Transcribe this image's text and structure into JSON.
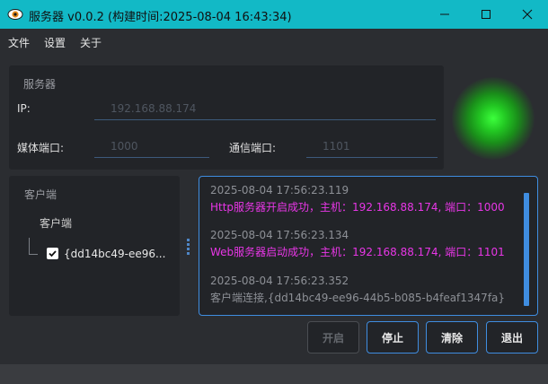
{
  "window": {
    "title": "服务器 v0.0.2 (构建时间:2025-08-04 16:43:34)",
    "accent_color": "#12b9c6"
  },
  "menu": {
    "items": [
      {
        "label": "文件"
      },
      {
        "label": "设置"
      },
      {
        "label": "关于"
      }
    ]
  },
  "server": {
    "group_label": "服务器",
    "ip_label": "IP:",
    "ip_placeholder": "192.168.88.174",
    "media_port_label": "媒体端口:",
    "media_port_placeholder": "1000",
    "comm_port_label": "通信端口:",
    "comm_port_placeholder": "1101"
  },
  "status_led": {
    "state": "on",
    "color": "#22c722"
  },
  "clients": {
    "group_label": "客户端",
    "tree_root": "客户端",
    "items": [
      {
        "label": "{dd14bc49-ee96...",
        "checked": true
      }
    ]
  },
  "log": {
    "entries": [
      {
        "time": "2025-08-04 17:56:23.119",
        "message": "Http服务器开启成功，主机：192.168.88.174, 端口：1000"
      },
      {
        "time": "2025-08-04 17:56:23.134",
        "message": "Web服务器启动成功，主机：192.168.88.174, 端口：1101"
      },
      {
        "time": "2025-08-04 17:56:23.352",
        "message": "客户端连接,{dd14bc49-ee96-44b5-b085-b4feaf1347fa}"
      }
    ]
  },
  "buttons": {
    "start": "开启",
    "stop": "停止",
    "clear": "清除",
    "exit": "退出"
  }
}
